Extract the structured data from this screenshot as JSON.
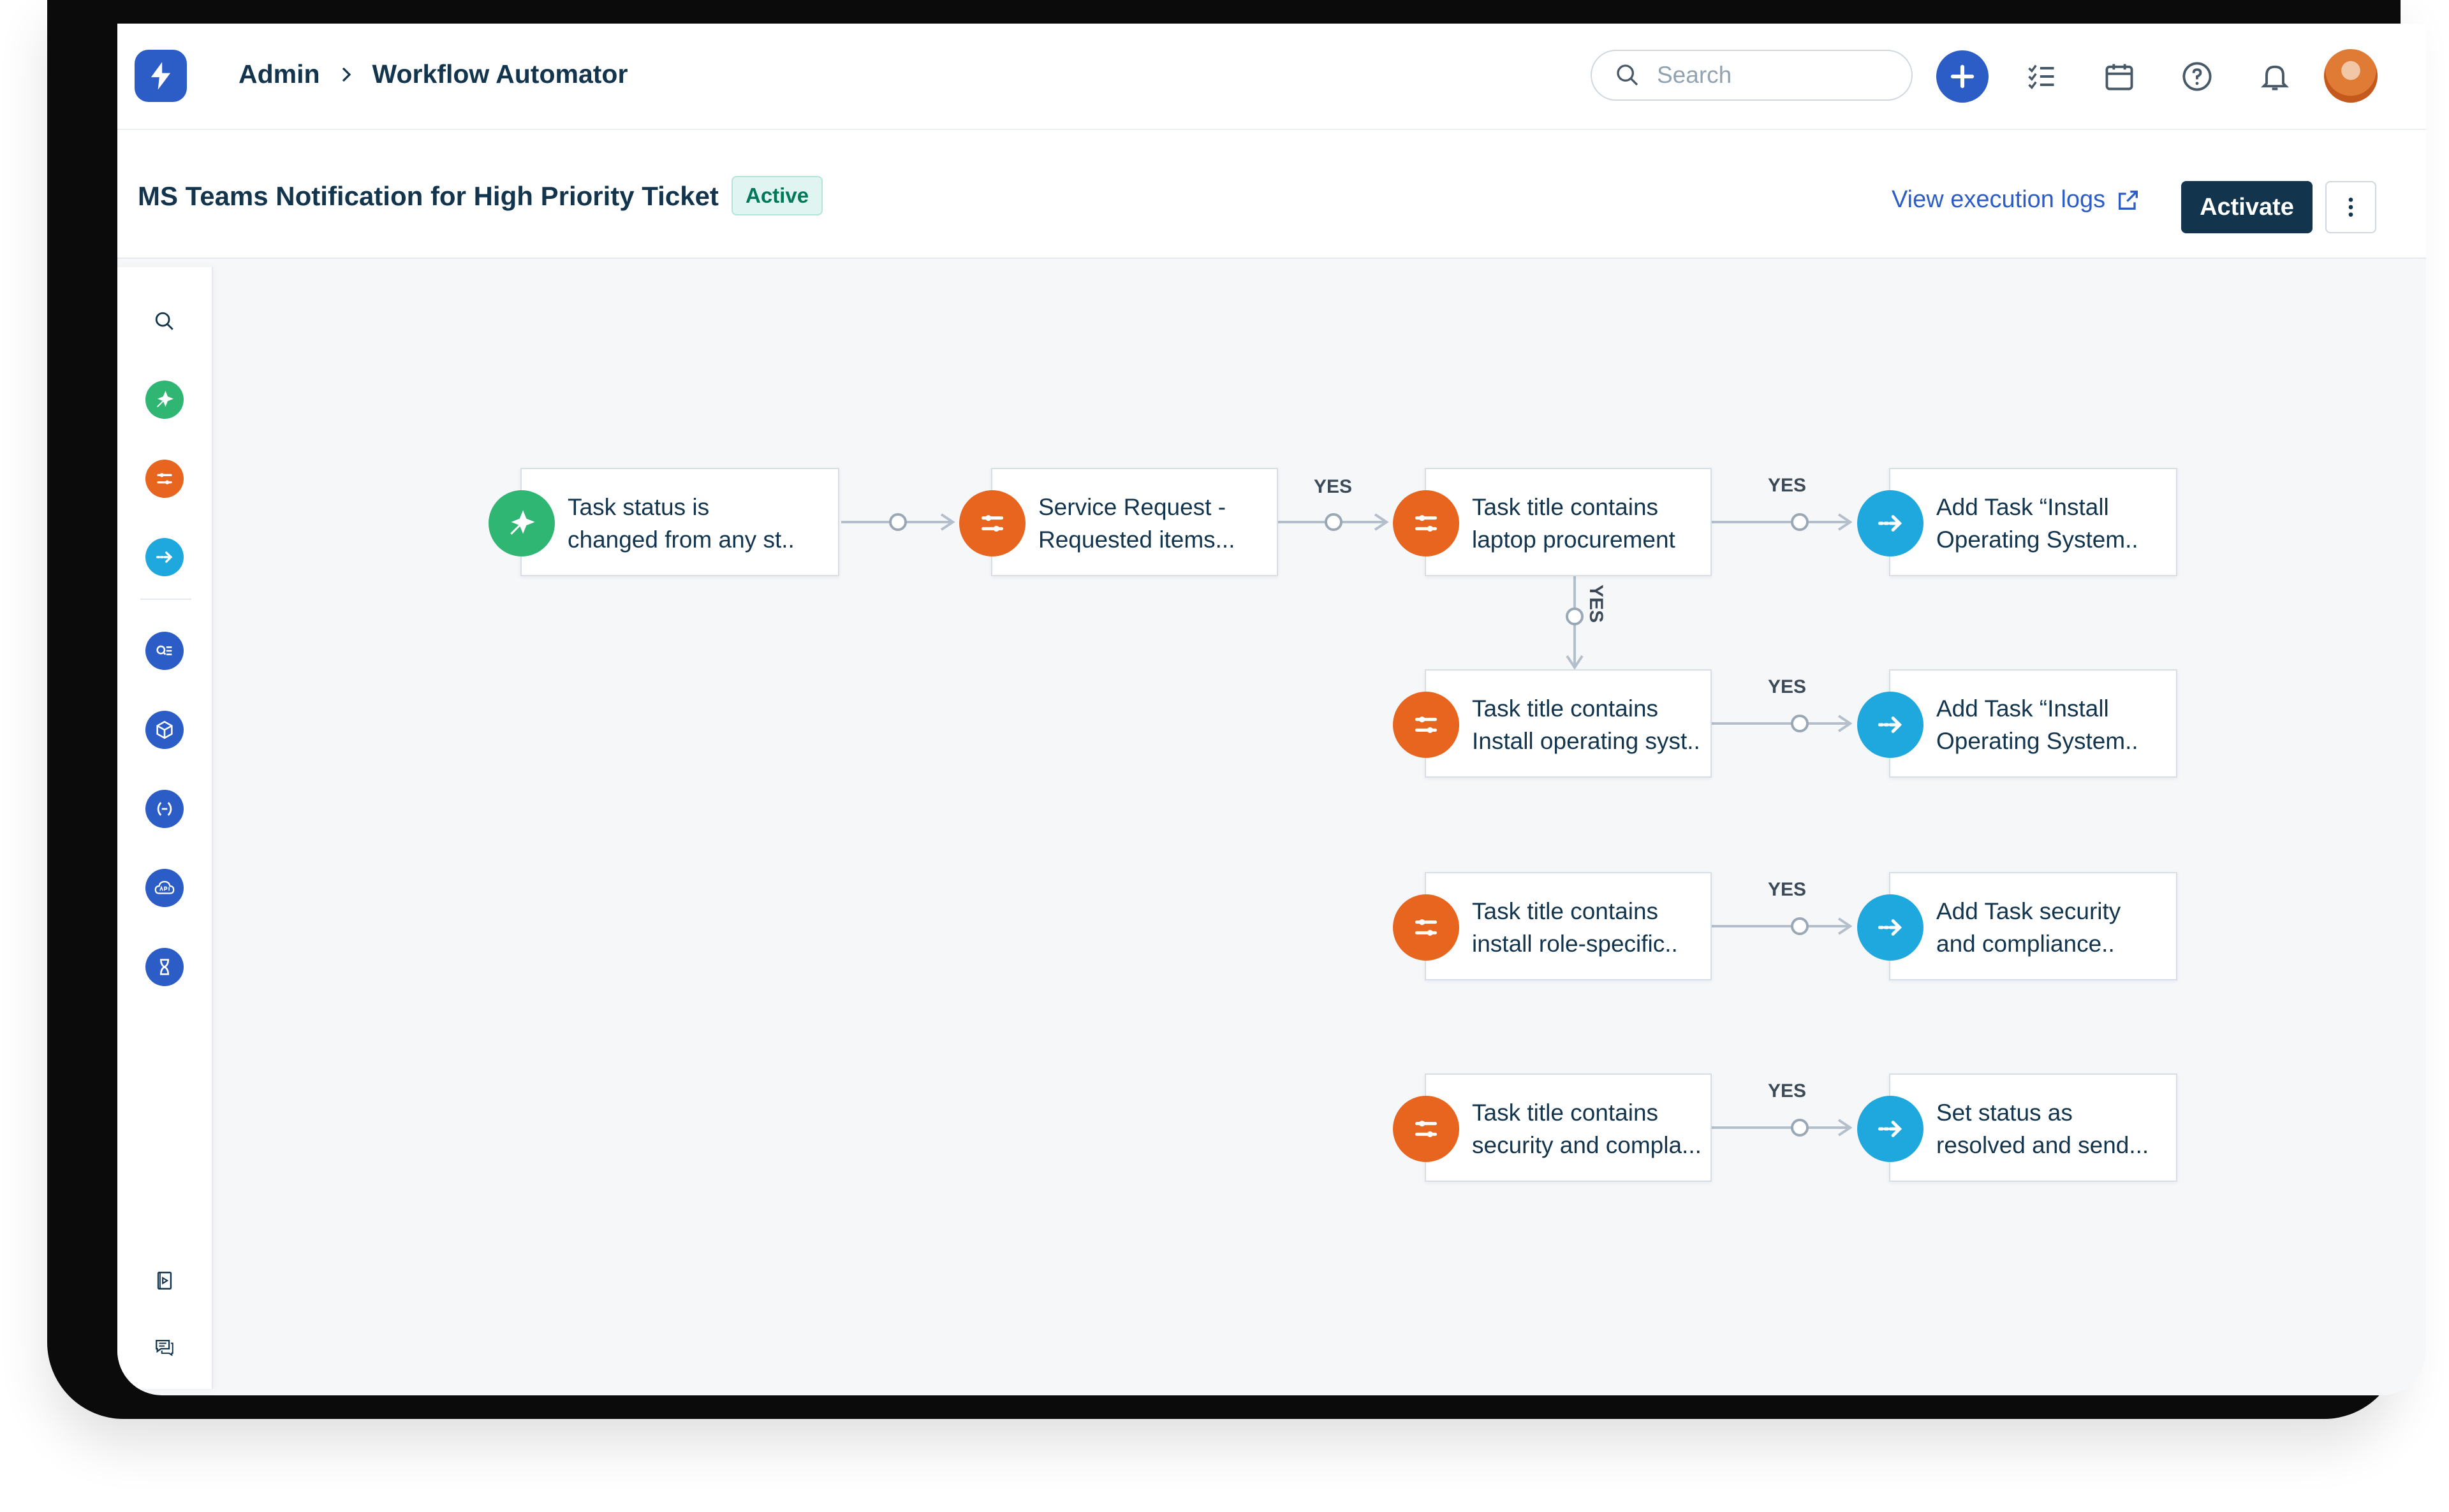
{
  "breadcrumb": {
    "root": "Admin",
    "current": "Workflow Automator"
  },
  "search": {
    "placeholder": "Search"
  },
  "workflow": {
    "title": "MS Teams Notification for High Priority Ticket",
    "status": "Active",
    "view_logs": "View execution logs",
    "activate": "Activate"
  },
  "topbar_icons": [
    "plus-icon",
    "checklist-icon",
    "calendar-icon",
    "help-icon",
    "bell-icon",
    "avatar"
  ],
  "palette": [
    "search-icon",
    "event-icon",
    "condition-icon",
    "action-icon",
    "query-icon",
    "app-icon",
    "expression-icon",
    "api-icon",
    "timer-icon",
    "playbook-icon",
    "feedback-icon"
  ],
  "colors": {
    "event": "#2fb673",
    "condition": "#e8651f",
    "action": "#1ea8dd",
    "primary": "#12344d",
    "link": "#2c5cc5"
  },
  "edge_label": "YES",
  "nodes": {
    "trigger": {
      "type": "event",
      "line1": "Task status is",
      "line2": "changed from any st.."
    },
    "service_request": {
      "type": "condition",
      "line1": "Service Request -",
      "line2": "Requested items..."
    },
    "cond_laptop": {
      "type": "condition",
      "line1": "Task title contains",
      "line2": "laptop procurement"
    },
    "act_install_os_1": {
      "type": "action",
      "line1": "Add Task “Install",
      "line2": "Operating System.."
    },
    "cond_install_os": {
      "type": "condition",
      "line1": "Task title contains",
      "line2": "Install operating syst.."
    },
    "act_install_os_2": {
      "type": "action",
      "line1": "Add Task “Install",
      "line2": "Operating System.."
    },
    "cond_role": {
      "type": "condition",
      "line1": "Task title contains",
      "line2": "install role-specific.."
    },
    "act_security": {
      "type": "action",
      "line1": "Add Task security",
      "line2": "and compliance.."
    },
    "cond_security": {
      "type": "condition",
      "line1": "Task title contains",
      "line2": "security and compla..."
    },
    "act_resolve": {
      "type": "action",
      "line1": "Set status as",
      "line2": "resolved and send..."
    }
  }
}
